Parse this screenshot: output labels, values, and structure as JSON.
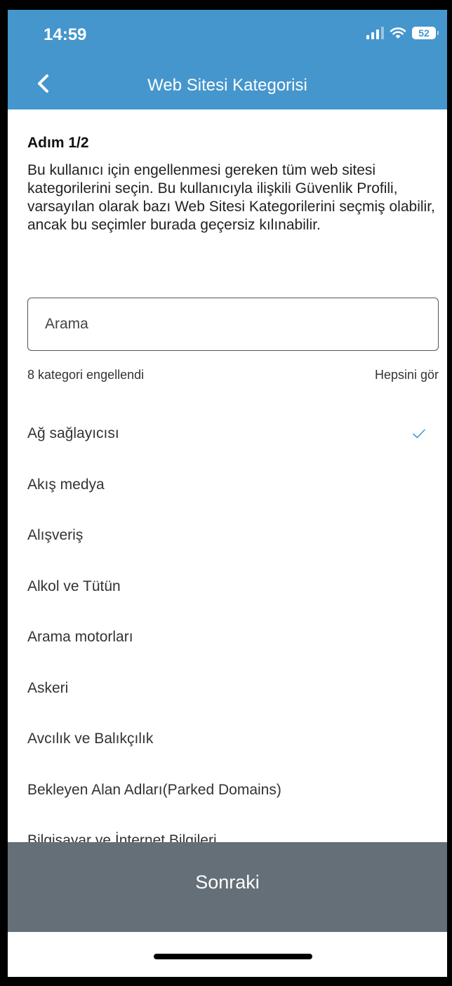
{
  "status_bar": {
    "time": "14:59",
    "battery": "52"
  },
  "nav": {
    "title": "Web Sitesi Kategorisi"
  },
  "step": "Adım 1/2",
  "description": "Bu kullanıcı için engellenmesi gereken tüm web sitesi kategorilerini seçin. Bu kullanıcıyla ilişkili Güvenlik Profili, varsayılan olarak bazı Web Sitesi Kategorilerini seçmiş olabilir, ancak bu seçimler burada geçersiz kılınabilir.",
  "search": {
    "placeholder": "Arama",
    "value": ""
  },
  "summary": {
    "blocked_count_text": "8 kategori engellendi",
    "see_all_label": "Hepsini gör"
  },
  "categories": [
    {
      "label": "Ağ sağlayıcısı",
      "selected": true
    },
    {
      "label": "Akış medya",
      "selected": false
    },
    {
      "label": "Alışveriş",
      "selected": false
    },
    {
      "label": "Alkol ve Tütün",
      "selected": false
    },
    {
      "label": "Arama motorları",
      "selected": false
    },
    {
      "label": "Askeri",
      "selected": false
    },
    {
      "label": "Avcılık ve Balıkçılık",
      "selected": false
    },
    {
      "label": "Bekleyen Alan Adları(Parked Domains)",
      "selected": false
    },
    {
      "label": "Bilgisayar ve İnternet Bilgileri",
      "selected": false
    }
  ],
  "footer": {
    "next_label": "Sonraki"
  },
  "colors": {
    "header": "#4596cc",
    "footer": "#656f78",
    "check": "#4596cc"
  },
  "icons": {
    "back": "chevron-left-icon",
    "check": "checkmark-icon",
    "signal": "cellular-signal-icon",
    "wifi": "wifi-icon"
  }
}
